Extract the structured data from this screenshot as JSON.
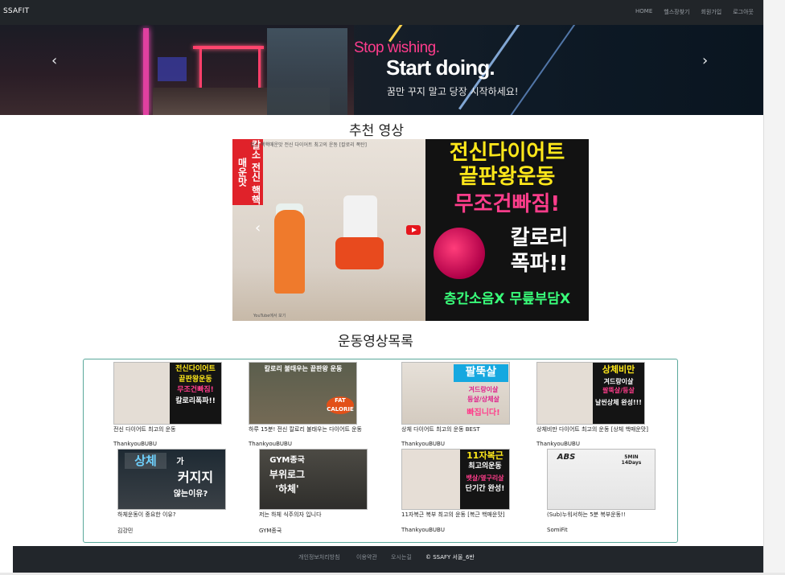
{
  "app": {
    "brand": "SSAFIT"
  },
  "nav": {
    "items": [
      "HOME",
      "헬스장찾기",
      "회원가입",
      "로그아웃"
    ]
  },
  "hero": {
    "line1": "Stop wishing.",
    "line2": "Start doing.",
    "line3": "꿈만 꾸지 말고 당장 시작하세요!"
  },
  "recommended": {
    "title": "추천 영상",
    "video_caption": [
      "전신다이어트",
      "끝판왕운동",
      "무조건빠짐!",
      "칼로리",
      "폭파!!",
      "층간소음X 무릎부담X"
    ],
    "side_tag": "칼소 전신 핵핵매운맛",
    "video_title": "칼소 핵핵매운맛 전신 다이어트 최고의 운동 [칼로리 폭탄]",
    "video_footer": "YouTube에서 보기"
  },
  "list": {
    "title": "운동영상목록",
    "videos": [
      {
        "title": "전신 다이어트 최고의 운동",
        "channel": "ThankyouBUBU",
        "thumb": [
          "전신다이어트",
          "끝판왕운동",
          "무조건빠짐!",
          "칼로리폭파!!"
        ]
      },
      {
        "title": "하루 15분! 전신 칼로리 불태우는 다이어트 운동",
        "channel": "ThankyouBUBU",
        "thumb": [
          "칼로리 불태우는 끝판왕 운동",
          "FAT CALORIE"
        ]
      },
      {
        "title": "상체 다이어트 최고의 운동 BEST",
        "channel": "ThankyouBUBU",
        "thumb": [
          "팔뚝살",
          "겨드랑이살",
          "등살/상체살",
          "빠집니다!"
        ]
      },
      {
        "title": "상체비만 다이어트 최고의 운동 [상체 핵매운맛]",
        "channel": "ThankyouBUBU",
        "thumb": [
          "상체비만",
          "겨드랑이살",
          "팔뚝살/등살",
          "날씬상체 완성!!!"
        ]
      },
      {
        "title": "하체운동이 중요한 이유?",
        "channel": "김강민",
        "thumb": [
          "상체",
          "가",
          "커지지",
          "않는이유?"
        ]
      },
      {
        "title": "저는 하체 식주의자 입니다",
        "channel": "GYM종국",
        "thumb": [
          "GYM종국",
          "부위로그",
          "'하체'"
        ]
      },
      {
        "title": "11자복근 복부 최고의 운동 [복근 핵매운맛]",
        "channel": "ThankyouBUBU",
        "thumb": [
          "11자복근",
          "최고의운동",
          "뱃살/옆구리살",
          "단기간 완성!"
        ]
      },
      {
        "title": "(Sub)누워서하는 5분 복부운동!!",
        "channel": "SomiFit",
        "thumb": [
          "ABS",
          "5MIN 14Days"
        ]
      }
    ]
  },
  "footer": {
    "links": [
      "개인정보처리방침",
      "이용약관",
      "오시는길"
    ],
    "copyright": "© SSAFY 서울_6반"
  },
  "colors": {
    "navbar": "#212529",
    "list_border": "#5aa89b",
    "hero_pink": "#ff3c8c",
    "yt_red": "#e5161d"
  }
}
